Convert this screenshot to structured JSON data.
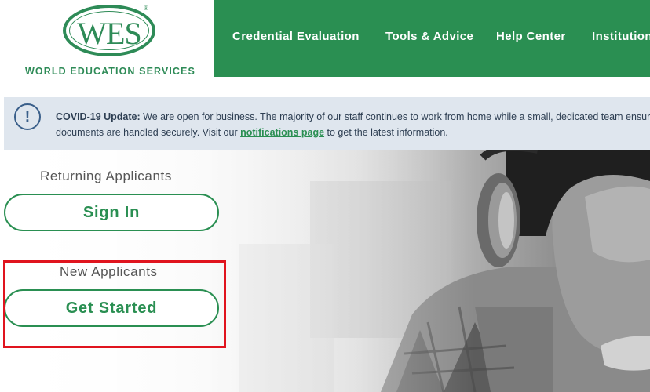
{
  "logo": {
    "mark": "WES",
    "registered": "®",
    "tagline": "WORLD EDUCATION SERVICES"
  },
  "nav": {
    "items": [
      "Credential Evaluation",
      "Tools & Advice",
      "Help Center",
      "Institutions"
    ]
  },
  "banner": {
    "heading": "COVID-19 Update:",
    "line1": " We are open for business. The majority of our staff continues to work from home while a small, dedicated team ensures that p",
    "line2_before": "documents are handled securely. Visit our ",
    "link": "notifications page",
    "line2_after": " to get the latest information."
  },
  "returning": {
    "label": "Returning Applicants",
    "button": "Sign In"
  },
  "new": {
    "label": "New Applicants",
    "button": "Get Started"
  },
  "colors": {
    "brand_green": "#2a8f52",
    "banner_bg": "#dfe6ee",
    "highlight": "#e0141e"
  },
  "icons": {
    "banner": "info-circle-icon"
  }
}
